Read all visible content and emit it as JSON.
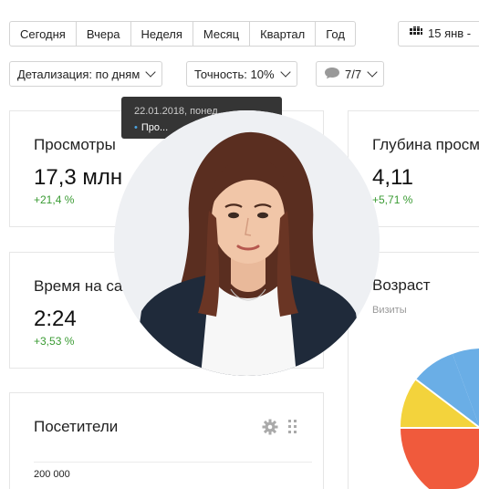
{
  "toolbar": {
    "periods": [
      "Сегодня",
      "Вчера",
      "Неделя",
      "Месяц",
      "Квартал",
      "Год"
    ],
    "date_range": "15 янв -",
    "detail": "Детализация: по дням",
    "accuracy": "Точность: 10%",
    "segments": "7/7"
  },
  "tooltip": {
    "date": "22.01.2018, понед...",
    "series": "Про..."
  },
  "cards": {
    "views": {
      "title": "Просмотры",
      "value": "17,3 млн",
      "delta": "+21,4 %"
    },
    "depth": {
      "title": "Глубина просм",
      "value": "4,11",
      "delta": "+5,71 %"
    },
    "time": {
      "title": "Время на сайте",
      "value": "2:24",
      "delta": "+3,53 %"
    },
    "age": {
      "title": "Возраст",
      "subtitle": "Визиты"
    },
    "visitors": {
      "title": "Посетители",
      "axis_label": "200 000"
    }
  },
  "colors": {
    "delta_green": "#3a9b33",
    "pie_purple": "#9b59c0",
    "pie_blue": "#6aaee6",
    "pie_yellow": "#f3d33c",
    "pie_red": "#f05a3c"
  }
}
